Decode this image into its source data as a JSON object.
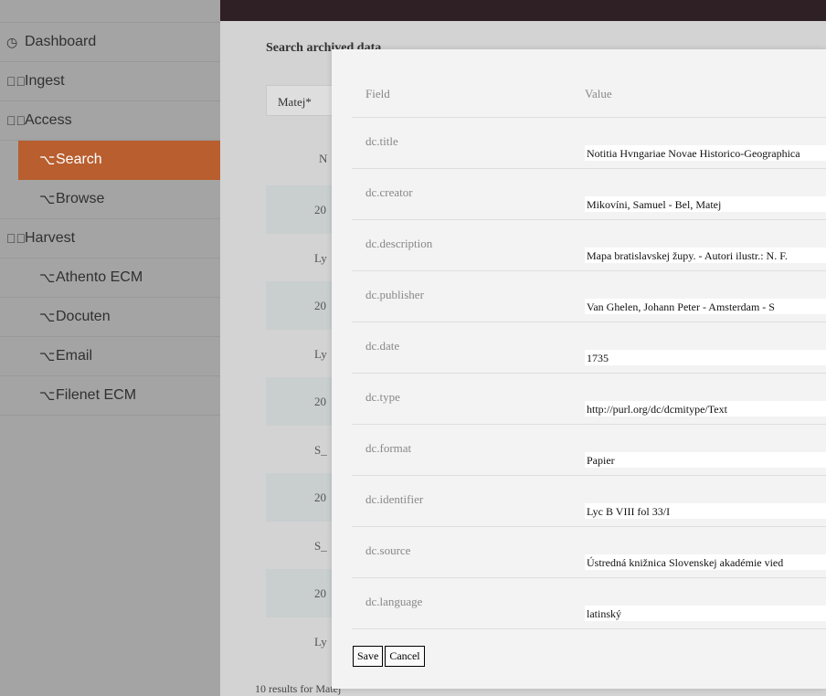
{
  "sidebar": {
    "items": [
      {
        "label": "Dashboard",
        "icon": "dashboard-icon"
      },
      {
        "label": "Ingest",
        "icon": "check-circle-icon"
      },
      {
        "label": "Access",
        "icon": "check-circle-icon"
      },
      {
        "label": "Search",
        "icon": "option-key-icon"
      },
      {
        "label": "Browse",
        "icon": "option-key-icon"
      },
      {
        "label": "Harvest",
        "icon": "check-circle-icon"
      },
      {
        "label": "Athento ECM",
        "icon": "option-key-icon"
      },
      {
        "label": "Docuten",
        "icon": "option-key-icon"
      },
      {
        "label": "Email",
        "icon": "option-key-icon"
      },
      {
        "label": "Filenet ECM",
        "icon": "option-key-icon"
      }
    ],
    "active_color": "#b85e2f"
  },
  "main": {
    "search_label": "Search archived data",
    "search_value": "Matej*",
    "column_header": "N",
    "rows": [
      "20",
      "Ly",
      "20",
      "Ly",
      "20",
      "S_",
      "20",
      "S_",
      "20",
      "Ly"
    ],
    "results_text": "10 results for Matej"
  },
  "modal": {
    "header_field": "Field",
    "header_value": "Value",
    "fields": [
      {
        "name": "dc.title",
        "value": "Notitia Hvngariae Novae Historico-Geographica"
      },
      {
        "name": "dc.creator",
        "value": "Mikovíni, Samuel - Bel, Matej"
      },
      {
        "name": "dc.description",
        "value": "Mapa bratislavskej župy. - Autori ilustr.: N. F."
      },
      {
        "name": "dc.publisher",
        "value": "Van Ghelen, Johann Peter - Amsterdam - S"
      },
      {
        "name": "dc.date",
        "value": "1735"
      },
      {
        "name": "dc.type",
        "value": "http://purl.org/dc/dcmitype/Text"
      },
      {
        "name": "dc.format",
        "value": "Papier"
      },
      {
        "name": "dc.identifier",
        "value": "Lyc B VIII fol 33/I"
      },
      {
        "name": "dc.source",
        "value": "Ústredná knižnica Slovenskej akadémie vied"
      },
      {
        "name": "dc.language",
        "value": "latinský"
      }
    ],
    "save_label": "Save",
    "cancel_label": "Cancel"
  }
}
